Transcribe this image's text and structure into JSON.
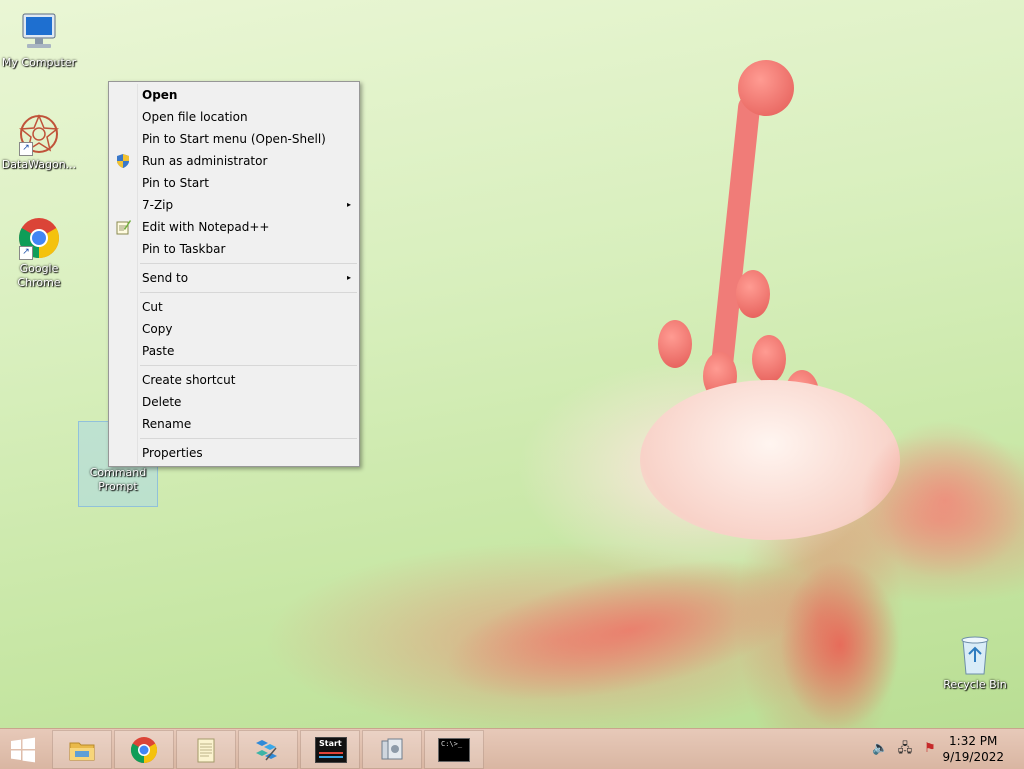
{
  "desktop": {
    "icons": [
      {
        "label": "My Computer"
      },
      {
        "label": "DataWagon..."
      },
      {
        "label": "Google Chrome"
      },
      {
        "label": "Command Prompt"
      },
      {
        "label": "Recycle Bin"
      }
    ]
  },
  "context_menu": {
    "items": [
      {
        "label": "Open"
      },
      {
        "label": "Open file location"
      },
      {
        "label": "Pin to Start menu (Open-Shell)"
      },
      {
        "label": "Run as administrator"
      },
      {
        "label": "Pin to Start"
      },
      {
        "label": "7-Zip"
      },
      {
        "label": "Edit with Notepad++"
      },
      {
        "label": "Pin to Taskbar"
      },
      {
        "label": "Send to"
      },
      {
        "label": "Cut"
      },
      {
        "label": "Copy"
      },
      {
        "label": "Paste"
      },
      {
        "label": "Create shortcut"
      },
      {
        "label": "Delete"
      },
      {
        "label": "Rename"
      },
      {
        "label": "Properties"
      }
    ],
    "submenu_arrow": "▸"
  },
  "taskbar": {
    "start_icon": "windows-logo-icon",
    "pinned": [
      {
        "name": "file-explorer-icon"
      },
      {
        "name": "chrome-icon"
      },
      {
        "name": "notepad-icon"
      },
      {
        "name": "registry-editor-icon"
      },
      {
        "name": "open-shell-start-icon",
        "text": "Start"
      },
      {
        "name": "system-settings-icon"
      },
      {
        "name": "command-prompt-icon",
        "text": "C:\\>_"
      }
    ],
    "tray": {
      "volume_glyph": "🔈",
      "network_glyph": "🖧",
      "flag_glyph": "⚑"
    },
    "clock": {
      "time": "1:32 PM",
      "date": "9/19/2022"
    }
  },
  "colors": {
    "taskbar": "#dcb9a5",
    "menu_bg": "#f0f0f0",
    "selection": "#add8e6"
  }
}
